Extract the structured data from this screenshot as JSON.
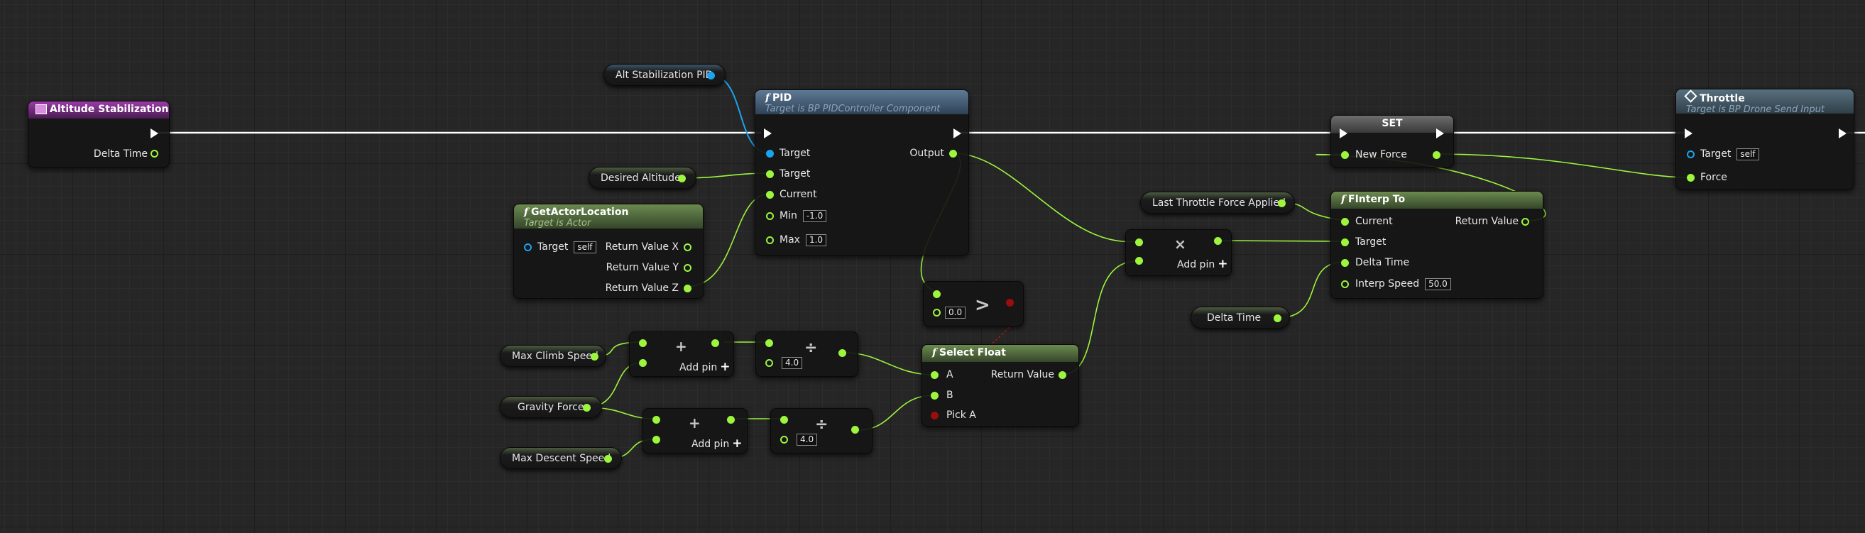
{
  "colors": {
    "exec": "#ffffff",
    "float": "#9df53d",
    "object": "#1aa3ef",
    "bool": "#9c0d0d",
    "function_header": "#4a6480",
    "event_header": "#8a2d96"
  },
  "event": {
    "title": "Altitude Stabilization",
    "delta_time": "Delta Time"
  },
  "pid": {
    "title": "PID",
    "subtitle": "Target is BP PIDController Component",
    "target_label": "Target",
    "target2_label": "Target",
    "current_label": "Current",
    "min_label": "Min",
    "min_value": "-1.0",
    "max_label": "Max",
    "max_value": "1.0",
    "output_label": "Output"
  },
  "vars": {
    "alt_pid": "Alt Stabilization PID",
    "desired_altitude": "Desired Altitude",
    "max_climb": "Max Climb Speed",
    "gravity": "Gravity Force",
    "max_descent": "Max Descent Speed",
    "last_throttle": "Last Throttle Force Applied",
    "delta_time": "Delta Time"
  },
  "get_actor_location": {
    "title": "GetActorLocation",
    "subtitle": "Target is Actor",
    "target_label": "Target",
    "target_value": "self",
    "rx": "Return Value X",
    "ry": "Return Value Y",
    "rz": "Return Value Z"
  },
  "greater": {
    "value": "0.0"
  },
  "add1": {
    "label": "Add pin"
  },
  "add2": {
    "label": "Add pin"
  },
  "divide1": {
    "value": "4.0"
  },
  "divide2": {
    "value": "4.0"
  },
  "multiply": {
    "label": "Add pin"
  },
  "select_float": {
    "title": "Select Float",
    "a": "A",
    "b": "B",
    "pick_a": "Pick A",
    "return": "Return Value"
  },
  "set": {
    "title": "SET",
    "new_force": "New Force"
  },
  "finterp": {
    "title": "FInterp To",
    "current": "Current",
    "target": "Target",
    "delta_time": "Delta Time",
    "interp_speed": "Interp Speed",
    "interp_value": "50.0",
    "return": "Return Value"
  },
  "throttle": {
    "title": "Throttle",
    "subtitle": "Target is BP Drone Send Input",
    "target_label": "Target",
    "target_value": "self",
    "force": "Force"
  }
}
